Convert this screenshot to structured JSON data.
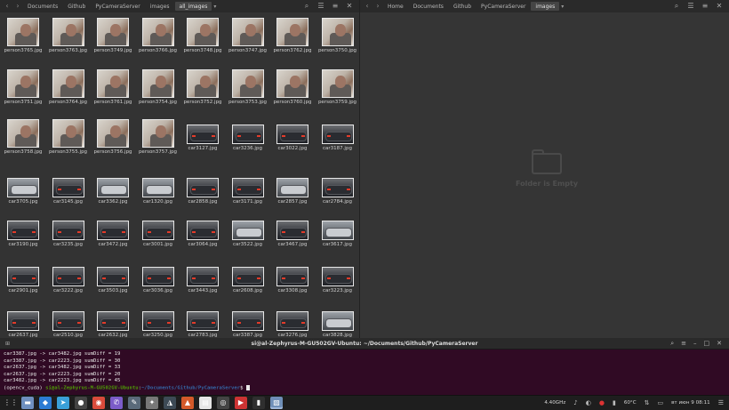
{
  "left_window": {
    "breadcrumbs": [
      "Documents",
      "Github",
      "PyCameraServer",
      "images",
      "all_images"
    ],
    "active_crumb_index": 4,
    "files": [
      [
        "person3765.jpg",
        "person3763.jpg",
        "person3749.jpg",
        "person3766.jpg",
        "person3748.jpg",
        "person3747.jpg",
        "person3762.jpg",
        "person3750.jpg"
      ],
      [
        "person3751.jpg",
        "person3764.jpg",
        "person3761.jpg",
        "person3754.jpg",
        "person3752.jpg",
        "person3753.jpg",
        "person3760.jpg",
        "person3759.jpg"
      ],
      [
        "person3758.jpg",
        "person3755.jpg",
        "person3756.jpg",
        "person3757.jpg",
        "car3127.jpg",
        "car3236.jpg",
        "car3022.jpg",
        "car3187.jpg"
      ],
      [
        "car3705.jpg",
        "car3145.jpg",
        "car3362.jpg",
        "car1320.jpg",
        "car2858.jpg",
        "car3171.jpg",
        "car2857.jpg",
        "car2784.jpg"
      ],
      [
        "car3190.jpg",
        "car3235.jpg",
        "car3472.jpg",
        "car3001.jpg",
        "car3064.jpg",
        "car3522.jpg",
        "car3467.jpg",
        "car3617.jpg"
      ],
      [
        "car2901.jpg",
        "car3222.jpg",
        "car3503.jpg",
        "car3036.jpg",
        "car3443.jpg",
        "car2608.jpg",
        "car3308.jpg",
        "car3223.jpg"
      ],
      [
        "car2637.jpg",
        "car2510.jpg",
        "car2632.jpg",
        "car3250.jpg",
        "car2783.jpg",
        "car3387.jpg",
        "car3276.jpg",
        "car3828.jpg"
      ]
    ]
  },
  "right_window": {
    "breadcrumbs": [
      "Home",
      "Documents",
      "Github",
      "PyCameraServer",
      "images"
    ],
    "active_crumb_index": 4,
    "empty_text": "Folder is Empty"
  },
  "terminal": {
    "title": "si@al-Zephyrus-M-GU502GV-Ubuntu: ~/Documents/Github/PyCameraServer",
    "lines": [
      "car3387.jpg -> car3482.jpg sumDiff = 19",
      "car3387.jpg -> car2223.jpg sumDiff = 30",
      "car2637.jpg -> car3482.jpg sumDiff = 33",
      "car2637.jpg -> car2223.jpg sumDiff = 20",
      "car3482.jpg -> car2223.jpg sumDiff = 45"
    ],
    "prompt_env": "(opencv_cuda) ",
    "prompt_user": "si@al-Zephyrus-M-GU502GV-Ubuntu",
    "prompt_sep": ":",
    "prompt_path": "~/Documents/Github/PyCameraServer",
    "prompt_end": "$ "
  },
  "taskbar": {
    "apps": [
      {
        "icon": "apps-grid-icon",
        "glyph": "⋮⋮",
        "color": "#1e1e1e"
      },
      {
        "icon": "files-icon",
        "glyph": "▬",
        "color": "#6e8fbf"
      },
      {
        "icon": "vscode-icon",
        "glyph": "◆",
        "color": "#2b7bd4"
      },
      {
        "icon": "telegram-icon",
        "glyph": "➤",
        "color": "#3aa0d8"
      },
      {
        "icon": "github-icon",
        "glyph": "●",
        "color": "#444444"
      },
      {
        "icon": "chrome-icon",
        "glyph": "◉",
        "color": "#d94b3b"
      },
      {
        "icon": "viber-icon",
        "glyph": "✆",
        "color": "#7b5cc8"
      },
      {
        "icon": "text-editor-icon",
        "glyph": "✎",
        "color": "#5a6a7a"
      },
      {
        "icon": "gimp-icon",
        "glyph": "✦",
        "color": "#777777"
      },
      {
        "icon": "monitor-icon",
        "glyph": "◮",
        "color": "#3d4a55"
      },
      {
        "icon": "store-icon",
        "glyph": "▲",
        "color": "#d45a2a"
      },
      {
        "icon": "document-viewer-icon",
        "glyph": "▤",
        "color": "#e6e6e6"
      },
      {
        "icon": "obs-icon",
        "glyph": "◎",
        "color": "#444444"
      },
      {
        "icon": "media-icon",
        "glyph": "▶",
        "color": "#c33"
      },
      {
        "icon": "terminal-icon",
        "glyph": "▮",
        "color": "#2f2f2f"
      },
      {
        "icon": "image-viewer-icon",
        "glyph": "▧",
        "color": "#6f8fb8"
      }
    ],
    "active_app_index": 15,
    "tray": {
      "cpu": "4.40GHz",
      "temp": "60°C",
      "datetime": "вт июн 9 08:11"
    }
  }
}
